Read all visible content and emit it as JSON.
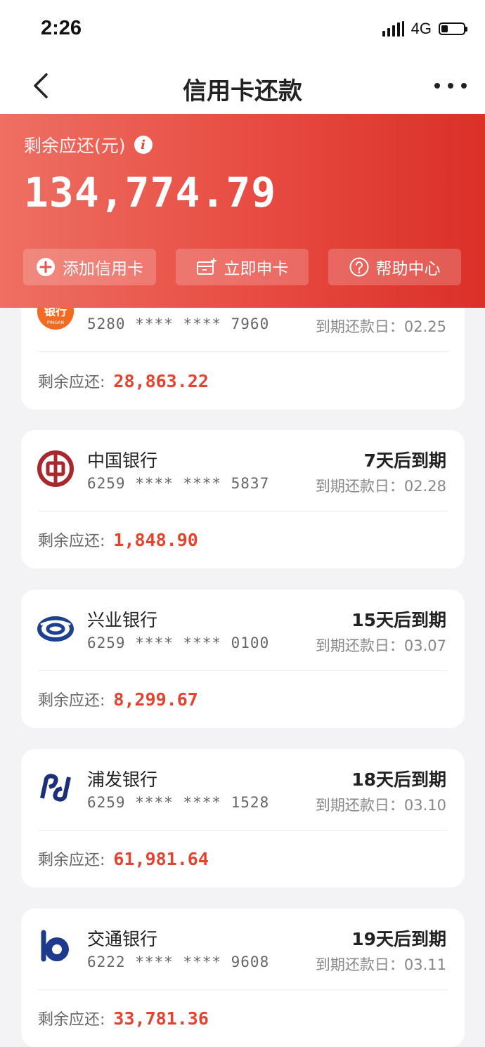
{
  "status_bar": {
    "time": "2:26",
    "network": "4G"
  },
  "nav": {
    "title": "信用卡还款"
  },
  "summary": {
    "label": "剩余应还(元)",
    "amount": "134,774.79",
    "actions": [
      {
        "label": "添加信用卡",
        "icon": "plus-circle-icon"
      },
      {
        "label": "立即申卡",
        "icon": "card-add-icon"
      },
      {
        "label": "帮助中心",
        "icon": "question-circle-icon"
      }
    ]
  },
  "cards": [
    {
      "bank": "",
      "logo_text": "银行",
      "logo_subtext": "PINGAN",
      "number": "5280 **** **** 7960",
      "due_title": "",
      "due_date": "到期还款日：02.25",
      "remain_label": "剩余应还:",
      "remain_amount": "28,863.22"
    },
    {
      "bank": "中国银行",
      "number": "6259 **** **** 5837",
      "due_title": "7天后到期",
      "due_date": "到期还款日：02.28",
      "remain_label": "剩余应还:",
      "remain_amount": "1,848.90"
    },
    {
      "bank": "兴业银行",
      "number": "6259 **** **** 0100",
      "due_title": "15天后到期",
      "due_date": "到期还款日：03.07",
      "remain_label": "剩余应还:",
      "remain_amount": "8,299.67"
    },
    {
      "bank": "浦发银行",
      "number": "6259 **** **** 1528",
      "due_title": "18天后到期",
      "due_date": "到期还款日：03.10",
      "remain_label": "剩余应还:",
      "remain_amount": "61,981.64"
    },
    {
      "bank": "交通银行",
      "number": "6222 **** **** 9608",
      "due_title": "19天后到期",
      "due_date": "到期还款日：03.11",
      "remain_label": "剩余应还:",
      "remain_amount": "33,781.36"
    }
  ],
  "colors": {
    "accent": "#e2442f",
    "header_start": "#ee6f63",
    "header_end": "#da3028"
  }
}
